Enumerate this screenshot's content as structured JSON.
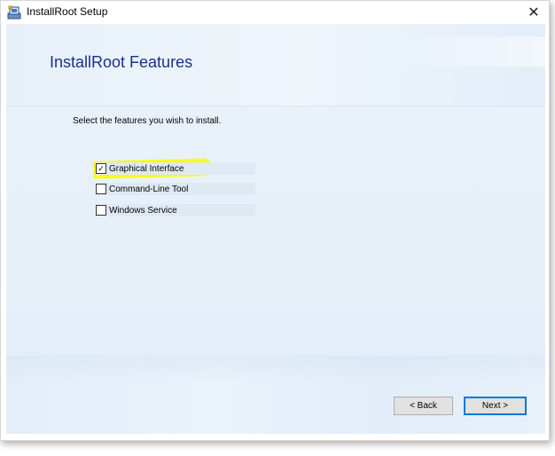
{
  "window": {
    "title": "InstallRoot Setup",
    "close_glyph": "✕"
  },
  "header": {
    "title": "InstallRoot Features"
  },
  "body": {
    "instruction": "Select the features you wish to install."
  },
  "features": [
    {
      "label": "Graphical Interface",
      "checked": true,
      "check_glyph": "✓"
    },
    {
      "label": "Command-Line Tool",
      "checked": false,
      "check_glyph": ""
    },
    {
      "label": "Windows Service",
      "checked": false,
      "check_glyph": ""
    }
  ],
  "buttons": {
    "back": "< Back",
    "next": "Next >"
  },
  "colors": {
    "title_blue": "#1b2f8a",
    "highlight_yellow": "#f6ff1c",
    "default_button_border": "#0078d7"
  },
  "icons": {
    "app": "installer-icon",
    "close": "close-icon",
    "check": "checkmark-icon"
  }
}
